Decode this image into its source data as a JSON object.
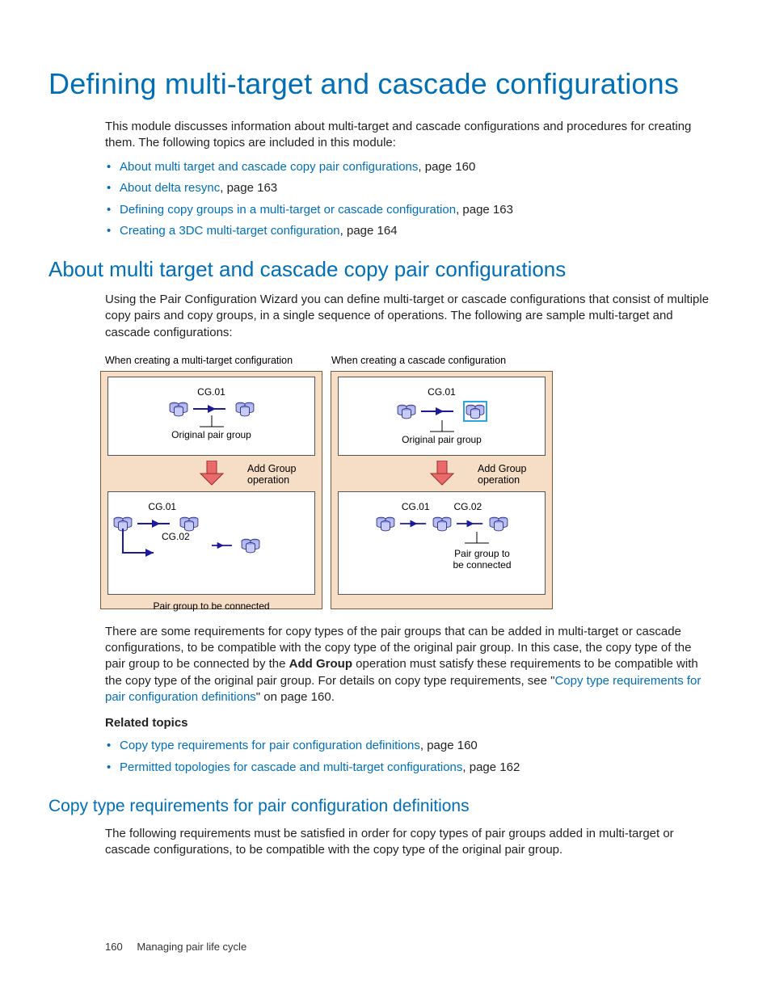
{
  "title": "Defining multi-target and cascade configurations",
  "intro": "This module discusses information about multi-target and cascade configurations and procedures for creating them. The following topics are included in this module:",
  "toc": [
    {
      "label": "About multi target and cascade copy pair configurations",
      "page": ", page 160"
    },
    {
      "label": "About delta resync",
      "page": ", page 163"
    },
    {
      "label": "Defining copy groups in a multi-target or cascade configuration",
      "page": ", page 163"
    },
    {
      "label": "Creating a 3DC multi-target configuration",
      "page": ", page 164"
    }
  ],
  "sec1": {
    "heading": "About multi target and cascade copy pair configurations",
    "para1": "Using the Pair Configuration Wizard you can define multi-target or cascade configurations that consist of multiple copy pairs and copy groups, in a single sequence of operations. The following are sample multi-target and cascade configurations:",
    "diagram": {
      "title_left": "When creating a multi-target configuration",
      "title_right": "When creating a cascade configuration",
      "cg01": "CG.01",
      "cg02": "CG.02",
      "orig": "Original pair group",
      "addgroup_l1": "Add Group",
      "addgroup_l2": "operation",
      "pgbc_l1": "Pair group to",
      "pgbc_l2": "be connected",
      "pgbc_single": "Pair group to be connected"
    },
    "para2_a": "There are some requirements for copy types of  the pair groups that can be added in multi-target or cascade configurations, to be compatible with the copy type of the original pair group. In this case, the copy type of the pair group to be connected by the ",
    "para2_bold": "Add Group",
    "para2_b": " operation must satisfy these requirements to be compatible with the copy type of the original pair group. For details on copy type requirements, see \"",
    "para2_link": "Copy type requirements for pair configuration definitions",
    "para2_c": "\" on page 160.",
    "related_head": "Related topics",
    "related": [
      {
        "label": "Copy type requirements for pair configuration definitions",
        "page": ", page 160"
      },
      {
        "label": "Permitted topologies for cascade and multi-target configurations",
        "page": ", page 162"
      }
    ]
  },
  "sec2": {
    "heading": "Copy type requirements for pair configuration definitions",
    "para": "The following requirements must be satisfied in order for copy types of pair groups added in multi-target or cascade configurations, to be compatible with the copy type of the original pair group."
  },
  "footer": {
    "page": "160",
    "chapter": "Managing pair life cycle"
  }
}
